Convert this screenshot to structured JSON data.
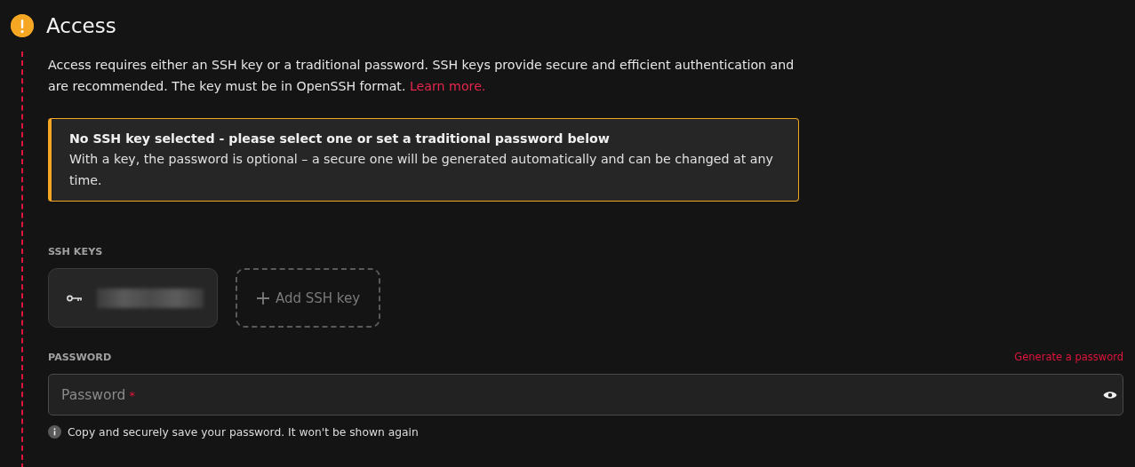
{
  "section": {
    "title": "Access",
    "warning": true,
    "intro": "Access requires either an SSH key or a traditional password. SSH keys provide secure and efficient authentication and are recommended. The key must be in OpenSSH format.",
    "intro_link": "Learn more.",
    "alert": {
      "title": "No SSH key selected - please select one or set a traditional password below",
      "body": "With a key, the password is optional – a secure one will be generated automatically and can be changed at any time."
    },
    "ssh_keys": {
      "label": "SSH KEYS",
      "keys": [
        {
          "kind": "key"
        }
      ],
      "add_button": "Add SSH key"
    },
    "password": {
      "label": "PASSWORD",
      "generate_link": "Generate a password",
      "placeholder": "Password",
      "required_mark": "*",
      "hint": "Copy and securely save your password. It won't be shown again"
    }
  }
}
